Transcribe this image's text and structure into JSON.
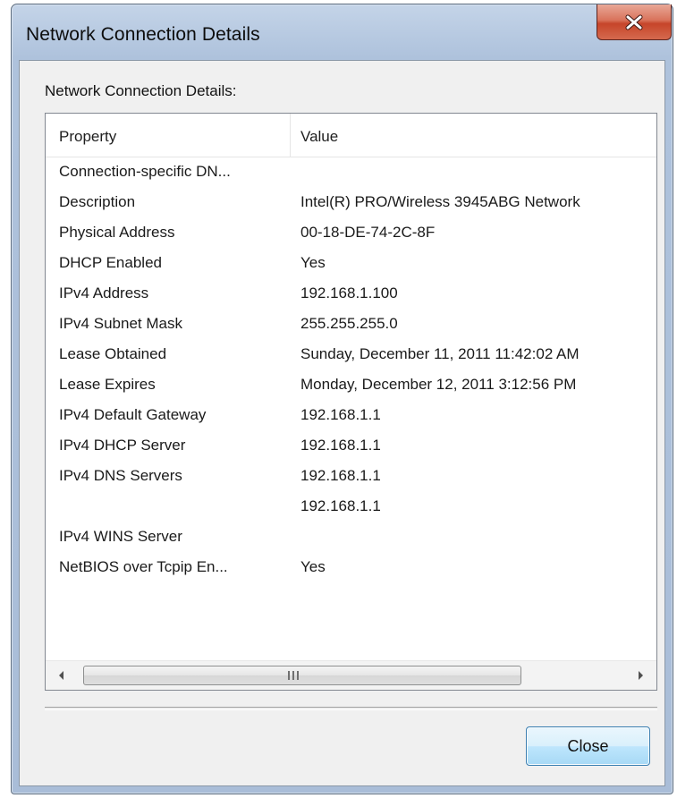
{
  "window": {
    "title": "Network Connection Details"
  },
  "group": {
    "label": "Network Connection Details:"
  },
  "list": {
    "columns": [
      "Property",
      "Value"
    ],
    "rows": [
      {
        "property": "Connection-specific DN...",
        "value": ""
      },
      {
        "property": "Description",
        "value": "Intel(R) PRO/Wireless 3945ABG Network"
      },
      {
        "property": "Physical Address",
        "value": "00-18-DE-74-2C-8F"
      },
      {
        "property": "DHCP Enabled",
        "value": "Yes"
      },
      {
        "property": "IPv4 Address",
        "value": "192.168.1.100"
      },
      {
        "property": "IPv4 Subnet Mask",
        "value": "255.255.255.0"
      },
      {
        "property": "Lease Obtained",
        "value": "Sunday, December 11, 2011 11:42:02 AM"
      },
      {
        "property": "Lease Expires",
        "value": "Monday, December 12, 2011 3:12:56 PM"
      },
      {
        "property": "IPv4 Default Gateway",
        "value": "192.168.1.1"
      },
      {
        "property": "IPv4 DHCP Server",
        "value": "192.168.1.1"
      },
      {
        "property": "IPv4 DNS Servers",
        "value": "192.168.1.1"
      },
      {
        "property": "",
        "value": "192.168.1.1"
      },
      {
        "property": "IPv4 WINS Server",
        "value": ""
      },
      {
        "property": "NetBIOS over Tcpip En...",
        "value": "Yes"
      }
    ]
  },
  "buttons": {
    "close_label": "Close"
  },
  "icons": {
    "title_close": "close-icon",
    "scroll_left": "chevron-left-icon",
    "scroll_right": "chevron-right-icon",
    "scroll_grip": "grip-icon"
  },
  "colors": {
    "titlebar": "#aec2dc",
    "close_button_red": "#c6452a",
    "dialog_bg": "#f0f0f0",
    "button_border": "#3c7fb1"
  }
}
